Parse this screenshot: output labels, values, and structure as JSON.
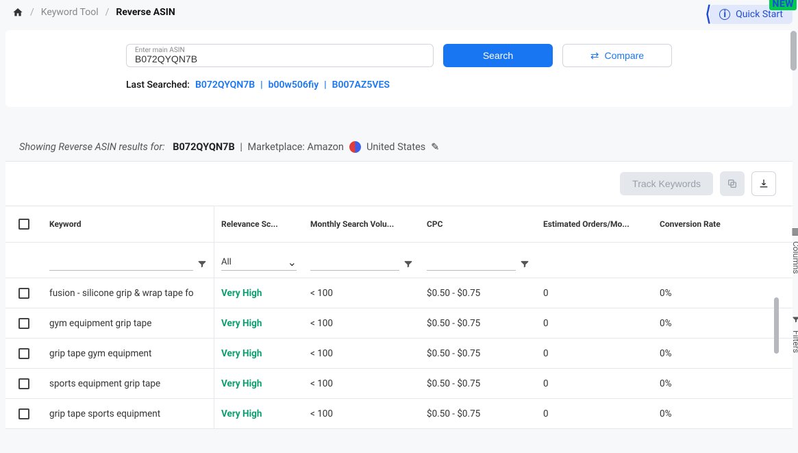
{
  "breadcrumb": {
    "tool": "Keyword Tool",
    "page": "Reverse ASIN"
  },
  "quickstart": {
    "label": "Quick Start",
    "newBadge": "NEW"
  },
  "search": {
    "label": "Enter main ASIN",
    "value": "B072QYQN7B",
    "searchBtn": "Search",
    "compareBtn": "Compare"
  },
  "lastSearched": {
    "label": "Last Searched:",
    "items": [
      "B072QYQN7B",
      "b00w506fiy",
      "B007AZ5VES"
    ]
  },
  "resultsInfo": {
    "prefix": "Showing Reverse ASIN results for:",
    "asin": "B072QYQN7B",
    "marketplace": "Marketplace: Amazon",
    "country": "United States"
  },
  "actions": {
    "trackKeywords": "Track Keywords"
  },
  "columns": {
    "keyword": "Keyword",
    "relevance": "Relevance Sc...",
    "volume": "Monthly Search Volu...",
    "cpc": "CPC",
    "orders": "Estimated Orders/Mo...",
    "conversion": "Conversion Rate"
  },
  "filters": {
    "relevanceAll": "All"
  },
  "rows": [
    {
      "keyword": "fusion - silicone grip & wrap tape fo",
      "relevance": "Very High",
      "volume": "< 100",
      "cpc": "$0.50 - $0.75",
      "orders": "0",
      "conversion": "0%"
    },
    {
      "keyword": "gym equipment grip tape",
      "relevance": "Very High",
      "volume": "< 100",
      "cpc": "$0.50 - $0.75",
      "orders": "0",
      "conversion": "0%"
    },
    {
      "keyword": "grip tape gym equipment",
      "relevance": "Very High",
      "volume": "< 100",
      "cpc": "$0.50 - $0.75",
      "orders": "0",
      "conversion": "0%"
    },
    {
      "keyword": "sports equipment grip tape",
      "relevance": "Very High",
      "volume": "< 100",
      "cpc": "$0.50 - $0.75",
      "orders": "0",
      "conversion": "0%"
    },
    {
      "keyword": "grip tape sports equipment",
      "relevance": "Very High",
      "volume": "< 100",
      "cpc": "$0.50 - $0.75",
      "orders": "0",
      "conversion": "0%"
    }
  ],
  "sideTabs": {
    "columns": "Columns",
    "filters": "Filters"
  }
}
